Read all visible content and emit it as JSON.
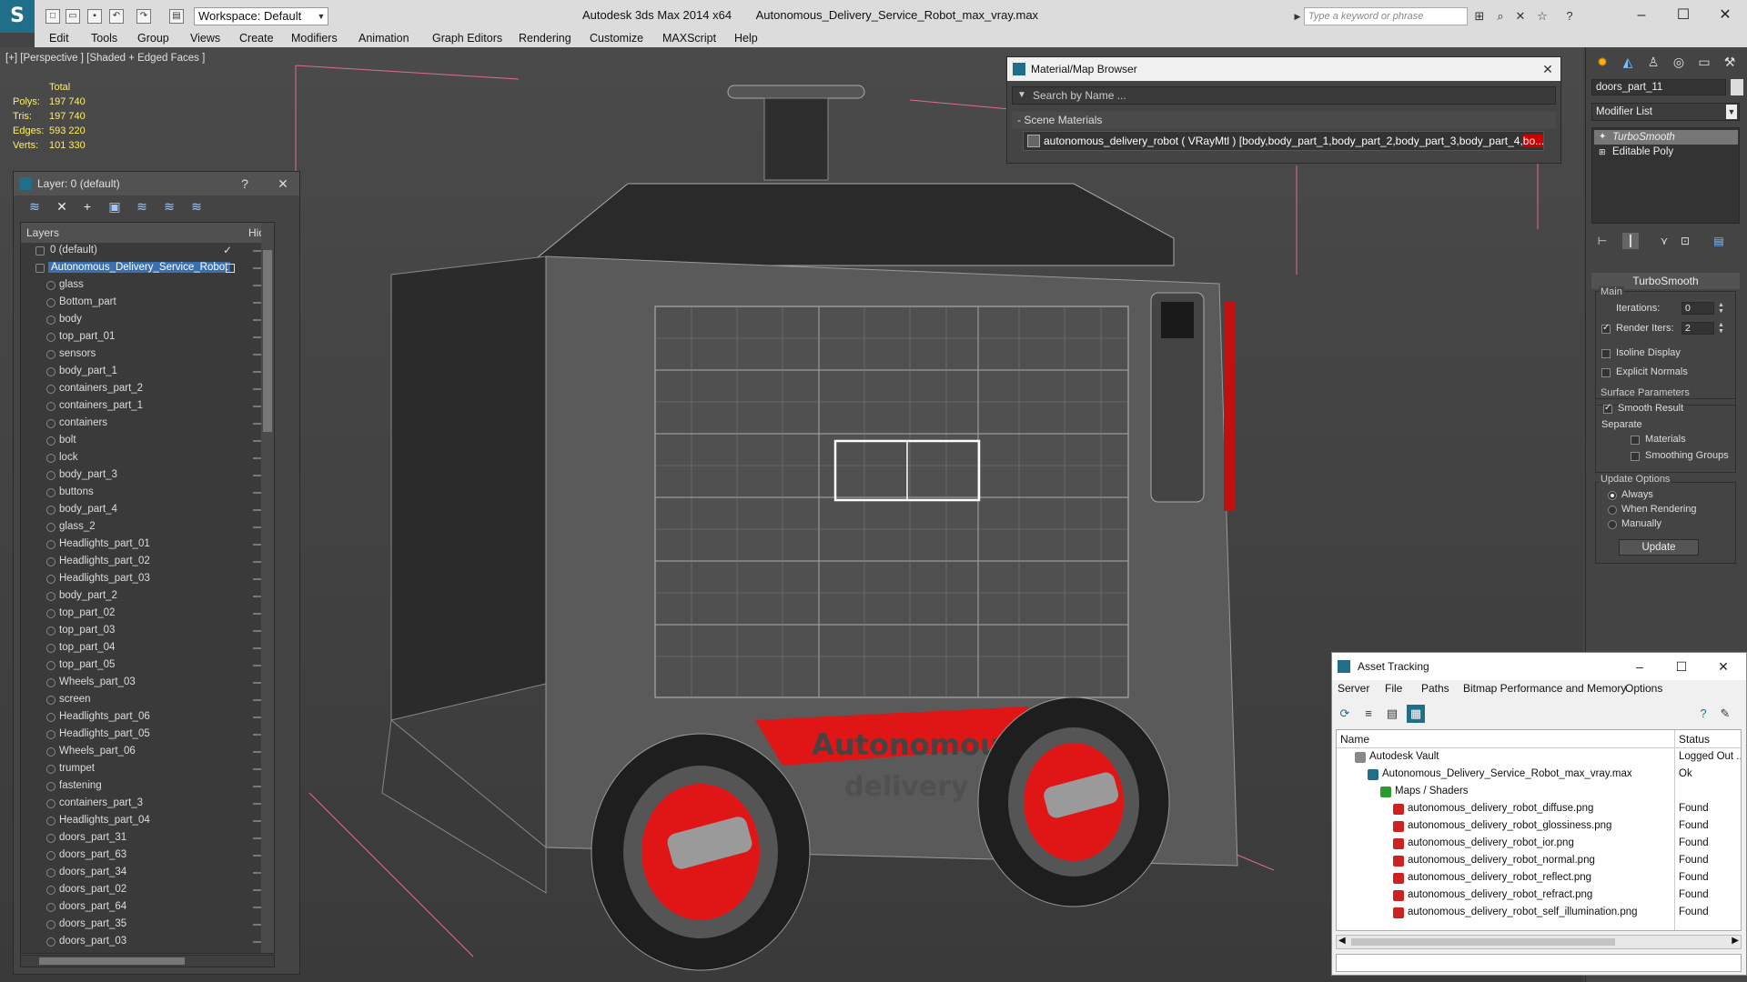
{
  "window": {
    "app": "Autodesk 3ds Max  2014 x64",
    "file": "Autonomous_Delivery_Service_Robot_max_vray.max",
    "workspace": "Workspace: Default",
    "search_placeholder": "Type a keyword or phrase"
  },
  "menu": [
    "Edit",
    "Tools",
    "Group",
    "Views",
    "Create",
    "Modifiers",
    "Animation",
    "Graph Editors",
    "Rendering",
    "Customize",
    "MAXScript",
    "Help"
  ],
  "viewport": {
    "label": "[+] [Perspective ] [Shaded + Edged Faces ]",
    "stats": {
      "total_label": "Total",
      "rows": [
        {
          "k": "Polys:",
          "v": "197 740"
        },
        {
          "k": "Tris:",
          "v": "197 740"
        },
        {
          "k": "Edges:",
          "v": "593 220"
        },
        {
          "k": "Verts:",
          "v": "101 330"
        }
      ]
    },
    "decal_line1": "Autonomous",
    "decal_line2": "delivery"
  },
  "layer_panel": {
    "title": "Layer: 0 (default)",
    "help": "?",
    "col_layers": "Layers",
    "col_hide": "Hide",
    "default_layer": "0 (default)",
    "selected_layer": "Autonomous_Delivery_Service_Robot",
    "objects": [
      "glass",
      "Bottom_part",
      "body",
      "top_part_01",
      "sensors",
      "body_part_1",
      "containers_part_2",
      "containers_part_1",
      "containers",
      "bolt",
      "lock",
      "body_part_3",
      "buttons",
      "body_part_4",
      "glass_2",
      "Headlights_part_01",
      "Headlights_part_02",
      "Headlights_part_03",
      "body_part_2",
      "top_part_02",
      "top_part_03",
      "top_part_04",
      "top_part_05",
      "Wheels_part_03",
      "screen",
      "Headlights_part_06",
      "Headlights_part_05",
      "Wheels_part_06",
      "trumpet",
      "fastening",
      "containers_part_3",
      "Headlights_part_04",
      "doors_part_31",
      "doors_part_63",
      "doors_part_34",
      "doors_part_02",
      "doors_part_64",
      "doors_part_35",
      "doors_part_03"
    ]
  },
  "material_browser": {
    "title": "Material/Map Browser",
    "search": "Search by Name ...",
    "section": "- Scene Materials",
    "item_main": "autonomous_delivery_robot ( VRayMtl ) [body,body_part_1,body_part_2,body_part_3,body_part_4,",
    "item_hl": "bo..."
  },
  "command_panel": {
    "object_name": "doors_part_11",
    "modifier_list": "Modifier List",
    "stack": [
      "TurboSmooth",
      "Editable Poly"
    ],
    "rollout": "TurboSmooth",
    "main_label": "Main",
    "iterations_label": "Iterations:",
    "iterations": "0",
    "render_iters_label": "Render Iters:",
    "render_iters": "2",
    "isoline": "Isoline Display",
    "explicit_normals": "Explicit Normals",
    "surface_params": "Surface Parameters",
    "smooth_result": "Smooth Result",
    "separate": "Separate",
    "materials": "Materials",
    "smoothing_groups": "Smoothing Groups",
    "update_options": "Update Options",
    "always": "Always",
    "when_rendering": "When Rendering",
    "manually": "Manually",
    "update": "Update"
  },
  "asset_tracking": {
    "title": "Asset Tracking",
    "menu": [
      "Server",
      "File",
      "Paths",
      "Bitmap Performance and Memory",
      "Options"
    ],
    "col_name": "Name",
    "col_status": "Status",
    "rows": [
      {
        "name": "Autodesk Vault",
        "status": "Logged Out ..."
      },
      {
        "name": "Autonomous_Delivery_Service_Robot_max_vray.max",
        "status": "Ok"
      },
      {
        "name": "Maps / Shaders",
        "status": ""
      },
      {
        "name": "autonomous_delivery_robot_diffuse.png",
        "status": "Found"
      },
      {
        "name": "autonomous_delivery_robot_glossiness.png",
        "status": "Found"
      },
      {
        "name": "autonomous_delivery_robot_ior.png",
        "status": "Found"
      },
      {
        "name": "autonomous_delivery_robot_normal.png",
        "status": "Found"
      },
      {
        "name": "autonomous_delivery_robot_reflect.png",
        "status": "Found"
      },
      {
        "name": "autonomous_delivery_robot_refract.png",
        "status": "Found"
      },
      {
        "name": "autonomous_delivery_robot_self_illumination.png",
        "status": "Found"
      }
    ]
  },
  "colors": {
    "accent": "#1f6f8b",
    "selection": "#3a6fb0",
    "decal_red": "#e01616"
  }
}
